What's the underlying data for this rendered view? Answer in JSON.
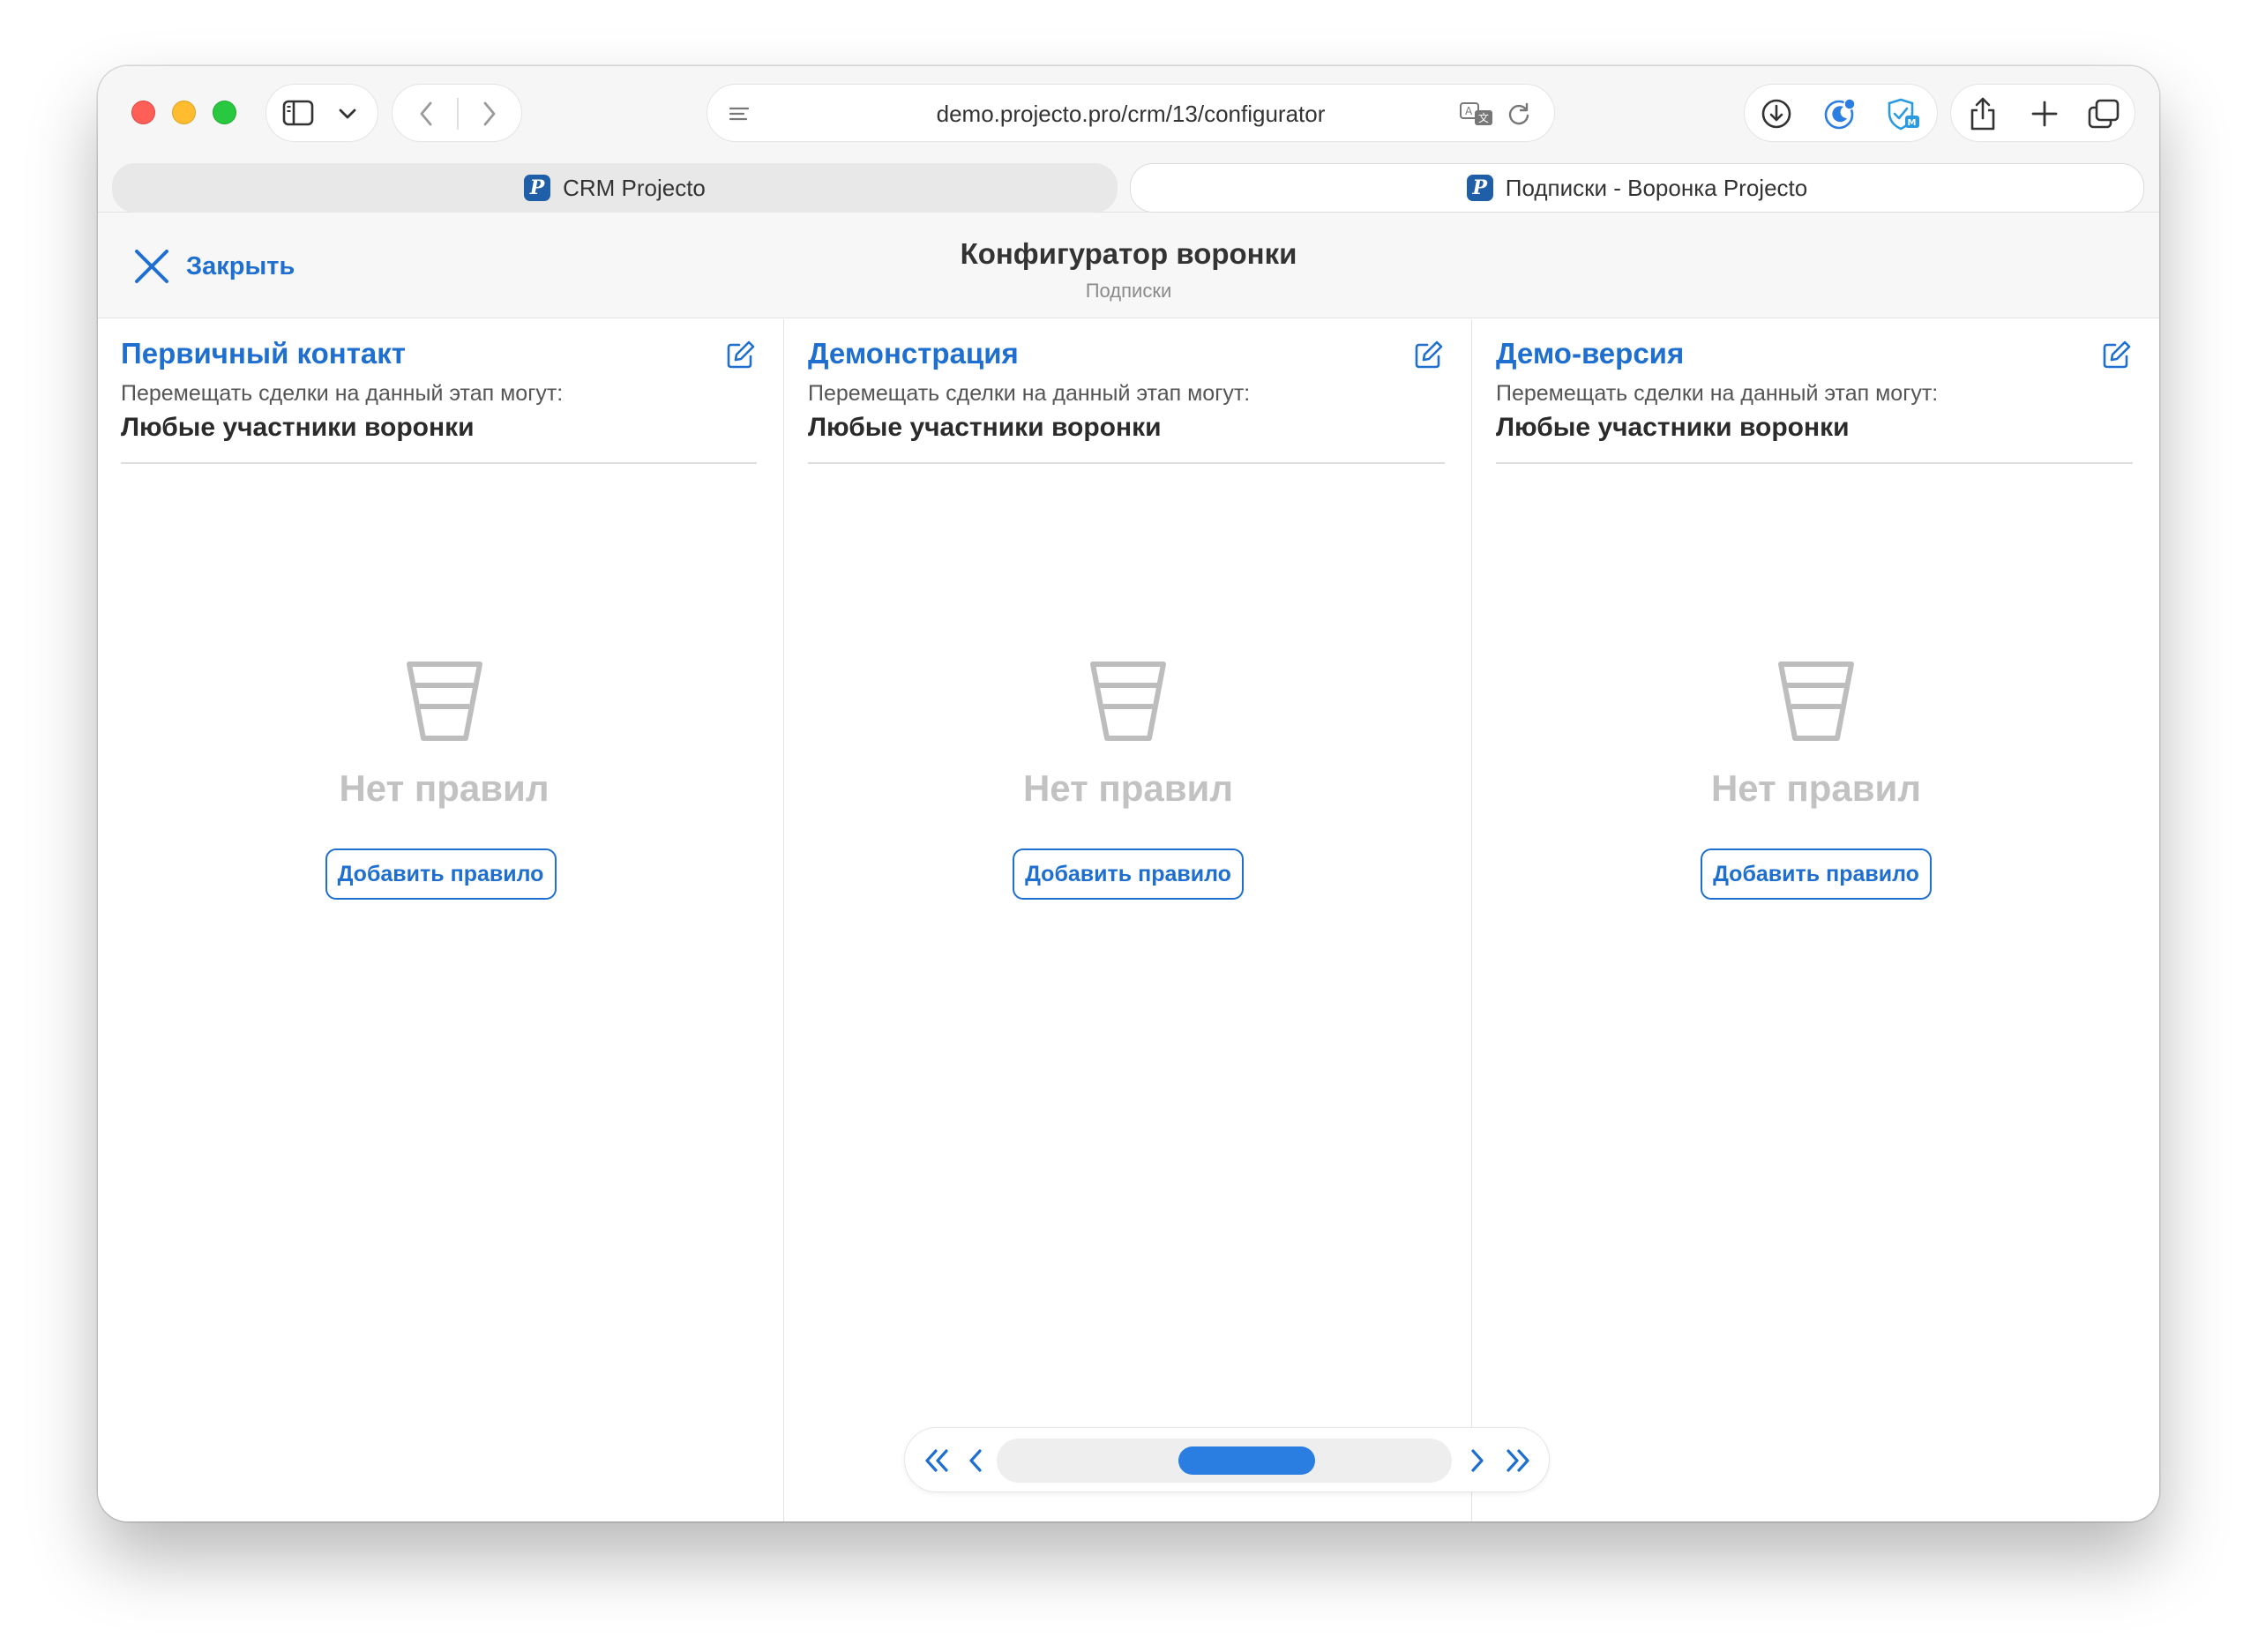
{
  "browser": {
    "url": "demo.projecto.pro/crm/13/configurator",
    "tabs": [
      {
        "label": "CRM Projecto",
        "favicon": "P",
        "active": false
      },
      {
        "label": "Подписки - Воронка Projecto",
        "favicon": "P",
        "active": true
      }
    ]
  },
  "header": {
    "close_label": "Закрыть",
    "title": "Конфигуратор воронки",
    "subtitle": "Подписки"
  },
  "stages": [
    {
      "title": "Первичный контакт",
      "permission_label": "Перемещать сделки на данный этап могут:",
      "permission_value": "Любые участники воронки",
      "empty_text": "Нет правил",
      "add_rule_label": "Добавить правило"
    },
    {
      "title": "Демонстрация",
      "permission_label": "Перемещать сделки на данный этап могут:",
      "permission_value": "Любые участники воронки",
      "empty_text": "Нет правил",
      "add_rule_label": "Добавить правило"
    },
    {
      "title": "Демо-версия",
      "permission_label": "Перемещать сделки на данный этап могут:",
      "permission_value": "Любые участники воронки",
      "empty_text": "Нет правил",
      "add_rule_label": "Добавить правило"
    }
  ],
  "scroller": {
    "thumb_start": 0.4,
    "thumb_size": 0.3
  },
  "colors": {
    "accent": "#1e6fd0",
    "thumb": "#2a7de1",
    "empty_text": "#c2c2c2"
  },
  "icons": {
    "close": "close-icon",
    "edit": "edit-icon",
    "empty": "funnel-icon",
    "first": "double-chevron-left-icon",
    "prev": "chevron-left-icon",
    "next": "chevron-right-icon",
    "last": "double-chevron-right-icon"
  }
}
